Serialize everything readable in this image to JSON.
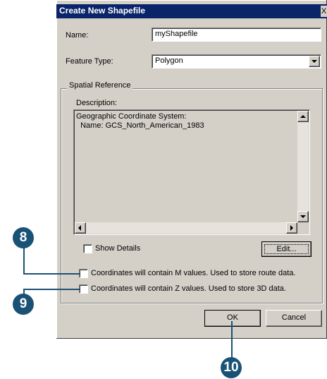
{
  "dialog": {
    "title": "Create New Shapefile",
    "close_glyph": "X"
  },
  "name_field": {
    "label": "Name:",
    "value": "myShapefile"
  },
  "feature_type": {
    "label": "Feature Type:",
    "value": "Polygon"
  },
  "spatial_reference": {
    "group_label": "Spatial Reference",
    "description_label": "Description:",
    "description_text": "Geographic Coordinate System:\n  Name: GCS_North_American_1983",
    "show_details_label": "Show Details",
    "edit_label": "Edit..."
  },
  "options": {
    "m_values_label": "Coordinates will contain M values. Used to store route data.",
    "z_values_label": "Coordinates will contain Z values. Used to store 3D data."
  },
  "buttons": {
    "ok_label": "OK",
    "cancel_label": "Cancel"
  },
  "callouts": {
    "step8": "8",
    "step9": "9",
    "step10": "10",
    "color": "#1a5276"
  }
}
